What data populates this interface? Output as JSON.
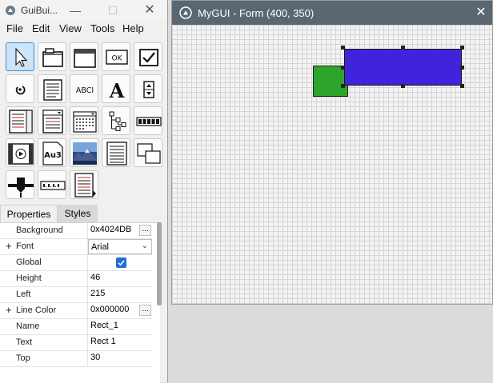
{
  "tool_window": {
    "title": "GuiBui...",
    "min_glyph": "—",
    "max_glyph": "☐",
    "close_glyph": "✕"
  },
  "menu": [
    "File",
    "Edit",
    "View",
    "Tools",
    "Help"
  ],
  "toolbox": {
    "ok_button_text": "OK",
    "label_text": "ABCI",
    "font_letter": "A",
    "updown_text": "Au3",
    "pointer_selected": true
  },
  "properties": {
    "tabs": [
      "Properties",
      "Styles"
    ],
    "rows": [
      {
        "name": "Background",
        "value": "0x4024DB",
        "expand": false,
        "kind": "dots"
      },
      {
        "name": "Font",
        "value": "Arial",
        "expand": true,
        "kind": "combo"
      },
      {
        "name": "Global",
        "value": "",
        "expand": false,
        "kind": "check",
        "checked": true
      },
      {
        "name": "Height",
        "value": "46",
        "expand": false,
        "kind": "text"
      },
      {
        "name": "Left",
        "value": "215",
        "expand": false,
        "kind": "text"
      },
      {
        "name": "Line Color",
        "value": "0x000000",
        "expand": true,
        "kind": "dots"
      },
      {
        "name": "Name",
        "value": "Rect_1",
        "expand": false,
        "kind": "text"
      },
      {
        "name": "Text",
        "value": "Rect 1",
        "expand": false,
        "kind": "text"
      },
      {
        "name": "Top",
        "value": "30",
        "expand": false,
        "kind": "text"
      }
    ],
    "plus_glyph": "+",
    "dots_glyph": "...",
    "chevron_glyph": "⌄"
  },
  "form_window": {
    "title": "MyGUI - Form (400, 350)",
    "close_glyph": "✕",
    "title_bar_color": "#5a6772"
  },
  "colors": {
    "selected_rect_fill": "#4024DB",
    "green_rect_fill": "#2ea52a",
    "accent": "#1f6fd0"
  }
}
